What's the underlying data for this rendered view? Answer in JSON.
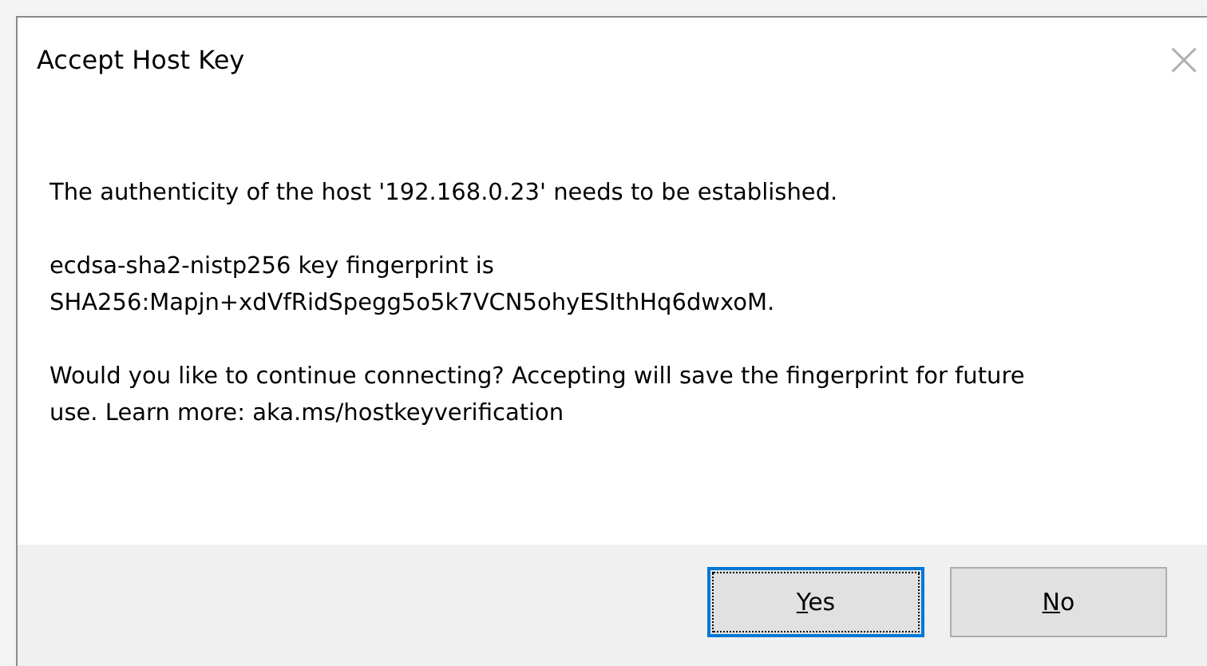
{
  "window": {
    "title": "Accept Host Key",
    "close": "×"
  },
  "paragraphs": [
    "The authenticity of the host '192.168.0.23' needs to be established.",
    "ecdsa-sha2-nistp256 key fingerprint is\nSHA256:Mapjn+xdVfRidSpegg5o5k7VCN5ohyESIthHq6dwxoM.",
    "Would you like to continue connecting? Accepting will save the fingerprint for future use. Learn more: aka.ms/hostkeyverification"
  ],
  "buttons": [
    {
      "access_key": "Y",
      "rest": "es",
      "focused": true
    },
    {
      "access_key": "N",
      "rest": "o",
      "focused": false
    }
  ]
}
